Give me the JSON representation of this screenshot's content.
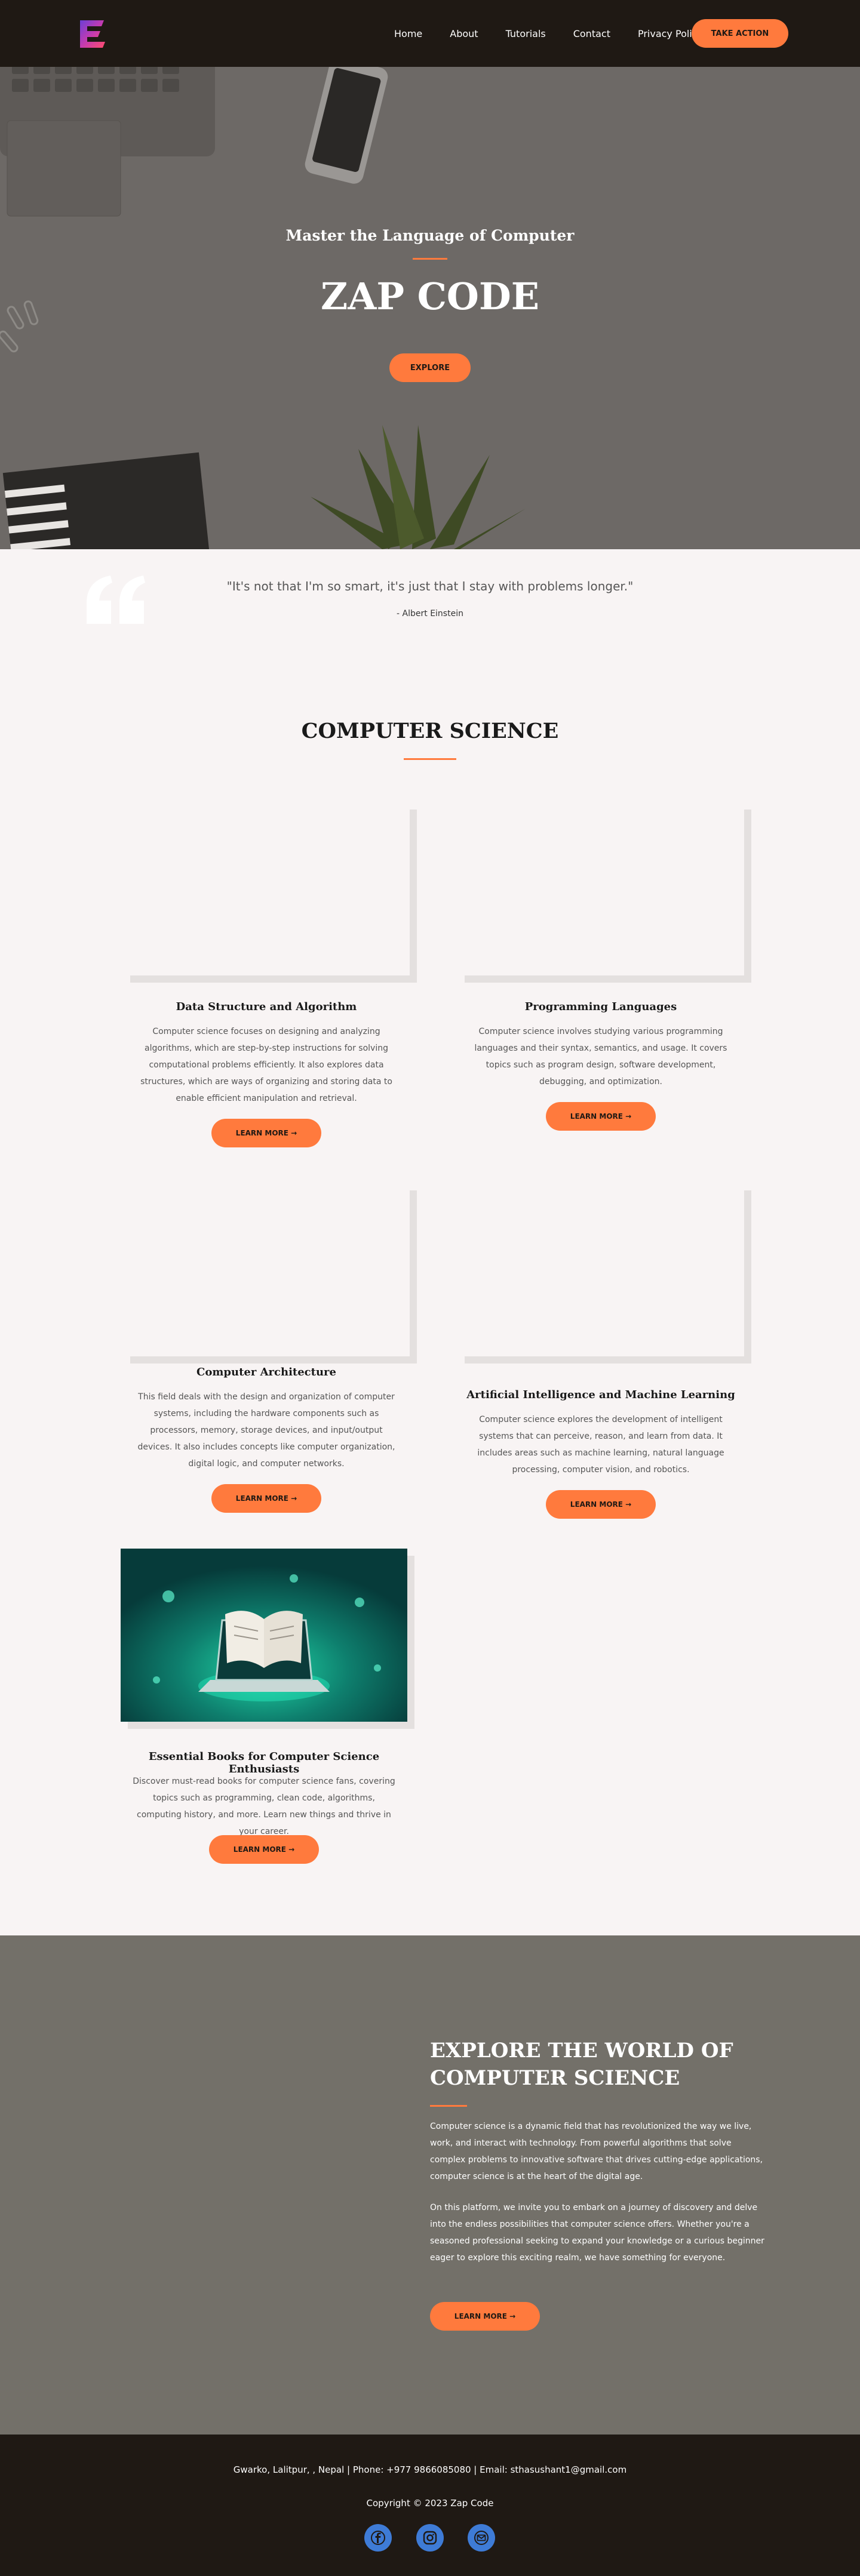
{
  "nav": {
    "links": [
      "Home",
      "About",
      "Tutorials",
      "Contact",
      "Privacy Policy"
    ],
    "cta": "TAKE ACTION"
  },
  "hero": {
    "subtitle": "Master the Language of Computer",
    "title": "ZAP CODE",
    "button": "EXPLORE"
  },
  "quote": {
    "text": "\"It's not that I'm so smart, it's just that I stay with problems longer.\"",
    "author": "- Albert Einstein"
  },
  "section": {
    "title": "COMPUTER SCIENCE"
  },
  "cards": [
    {
      "title": "Data Structure and Algorithm",
      "desc": "Computer science focuses on designing and analyzing algorithms, which are step-by-step instructions for solving computational problems efficiently. It also explores data structures, which are ways of organizing and storing data to enable efficient manipulation and retrieval.",
      "button": "LEARN MORE"
    },
    {
      "title": "Programming Languages",
      "desc": "Computer science involves studying various programming languages and their syntax, semantics, and usage. It covers topics such as program design, software development, debugging, and optimization.",
      "button": "LEARN MORE"
    },
    {
      "title": "Computer Architecture",
      "desc": "This field deals with the design and organization of computer systems, including the hardware components such as processors, memory, storage devices, and input/output devices. It also includes concepts like computer organization, digital logic, and computer networks.",
      "button": "LEARN MORE"
    },
    {
      "title": "Artificial Intelligence and Machine Learning",
      "desc": "Computer science explores the development of intelligent systems that can perceive, reason, and learn from data. It includes areas such as machine learning, natural language processing, computer vision, and robotics.",
      "button": "LEARN MORE"
    },
    {
      "title": "Essential Books for Computer Science Enthusiasts",
      "desc": "Discover must-read books for computer science fans, covering topics such as programming, clean code, algorithms, computing history, and more. Learn new things and thrive in your career.",
      "button": "LEARN MORE"
    }
  ],
  "world": {
    "title": "EXPLORE THE WORLD OF COMPUTER SCIENCE",
    "p1": "Computer science is a dynamic field that has revolutionized the way we live, work, and interact with technology. From powerful algorithms that solve complex problems to innovative software that drives cutting-edge applications, computer science is at the heart of the digital age.",
    "p2": "On this platform, we invite you to embark on a journey of discovery and delve into the endless possibilities that computer science offers. Whether you're a seasoned professional seeking to expand your knowledge or a curious beginner eager to explore this exciting realm, we have something for everyone.",
    "button": "LEARN MORE"
  },
  "footer": {
    "contact": "Gwarko, Lalitpur, , Nepal | Phone: +977 9866085080 | Email: sthasushant1@gmail.com",
    "copyright": "Copyright © 2023 Zap Code",
    "social": [
      "facebook-icon",
      "instagram-icon",
      "email-icon"
    ]
  },
  "colors": {
    "accent": "#ff7a3d",
    "dark": "#1f1914",
    "hero_bg": "#6d6966",
    "page_bg": "#f8f4f4",
    "social": "#3e7bd6"
  }
}
